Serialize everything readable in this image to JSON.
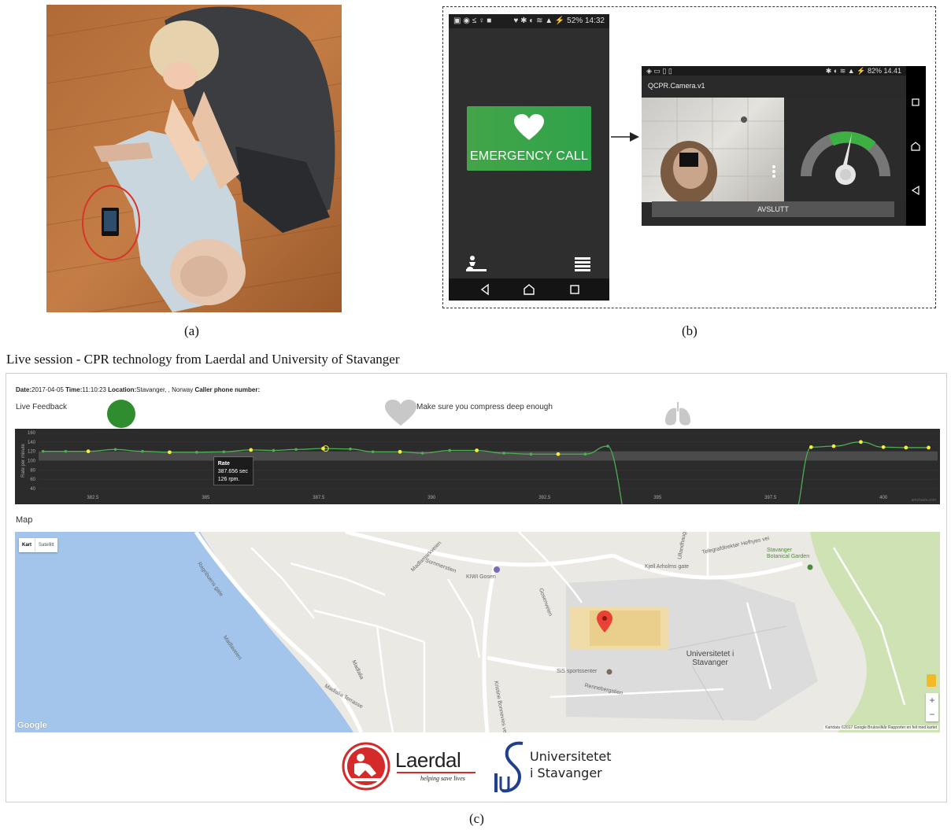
{
  "captions": {
    "a": "(a)",
    "b": "(b)",
    "c": "(c)"
  },
  "phone_app": {
    "status_time": "14:32",
    "status_battery": "52%",
    "emergency_label": "EMERGENCY CALL"
  },
  "camera_app": {
    "status_time": "14.41",
    "status_battery": "82%",
    "app_title": "QCPR.Camera.v1",
    "end_button": "AVSLUTT"
  },
  "session": {
    "title": "Live session - CPR technology from Laerdal and University of Stavanger",
    "date_label": "Date:",
    "date_value": "2017-04-05",
    "time_label": "Time:",
    "time_value": "11:10:23",
    "location_label": "Location:",
    "location_value": "Stavanger, , Norway",
    "phone_label": "Caller phone number:",
    "live_feedback_label": "Live Feedback",
    "feedback_message": "Make sure you compress deep enough",
    "map_label": "Map"
  },
  "chart_data": {
    "type": "line",
    "ylabel": "Rate per minute",
    "ylim": [
      40,
      160
    ],
    "yticks": [
      40,
      60,
      80,
      100,
      120,
      140,
      160
    ],
    "xlim": [
      381.3,
      401.2
    ],
    "xticks": [
      382.5,
      385,
      387.5,
      390,
      392.5,
      395,
      397.5,
      400
    ],
    "target_band": [
      100,
      120
    ],
    "line_color": "#4caf50",
    "point_color": "#f5ee3a",
    "x": [
      381.4,
      381.9,
      382.4,
      383.0,
      383.6,
      384.2,
      384.8,
      385.4,
      386.0,
      386.5,
      387.0,
      387.6,
      388.2,
      388.7,
      389.3,
      389.8,
      390.4,
      391.0,
      391.6,
      392.2,
      392.8,
      393.4,
      393.9
    ],
    "y": [
      120,
      120,
      120,
      124,
      120,
      118,
      118,
      119,
      123,
      122,
      124,
      126,
      125,
      119,
      119,
      116,
      122,
      122,
      116,
      114,
      114,
      114,
      131
    ],
    "x_after_gap": [
      398.4,
      398.9,
      399.5,
      400.0,
      400.5,
      401.0
    ],
    "y_after_gap": [
      129,
      131,
      140,
      129,
      128,
      128
    ],
    "tooltip": {
      "title": "Rate",
      "line1": "387.656 sec",
      "line2": "126 rpm."
    },
    "watermark": "amcharts.com"
  },
  "map": {
    "toggle_map": "Kart",
    "toggle_satellite": "Satellitt",
    "google": "Google",
    "attribution": "Kartdata ©2017 Google  Bruksvilkår  Rapporter en feil med kartet",
    "zoom_in": "+",
    "zoom_out": "−",
    "labels": {
      "madlaveien": "Madlaveien",
      "madlalia_terrasse": "Madlalia Terrasse",
      "madlalia": "Madlalia",
      "madlamarkveien": "Madlamarkveien",
      "sommerstien": "Sommerstien",
      "kiwi": "KIWI Gosen",
      "gosenveien": "Gosenveien",
      "kjell": "Kjell Arholms gate",
      "telegraf": "Telegrafdirektør Hefhyes vei",
      "botanical": "Stavanger Botanical Garden",
      "universitet": "Universitetet i Stavanger",
      "sis": "SiS sportssenter",
      "rennebergstien": "Rennebergstien",
      "kristine": "Kristine Bonnevies vei",
      "ullandhaug": "Ullandhaug",
      "regnbuens": "Regnbuens gate"
    }
  },
  "logos": {
    "laerdal": "Laerdal",
    "laerdal_tagline": "helping save lives",
    "uis_line1": "Universitetet",
    "uis_line2": "i Stavanger"
  }
}
